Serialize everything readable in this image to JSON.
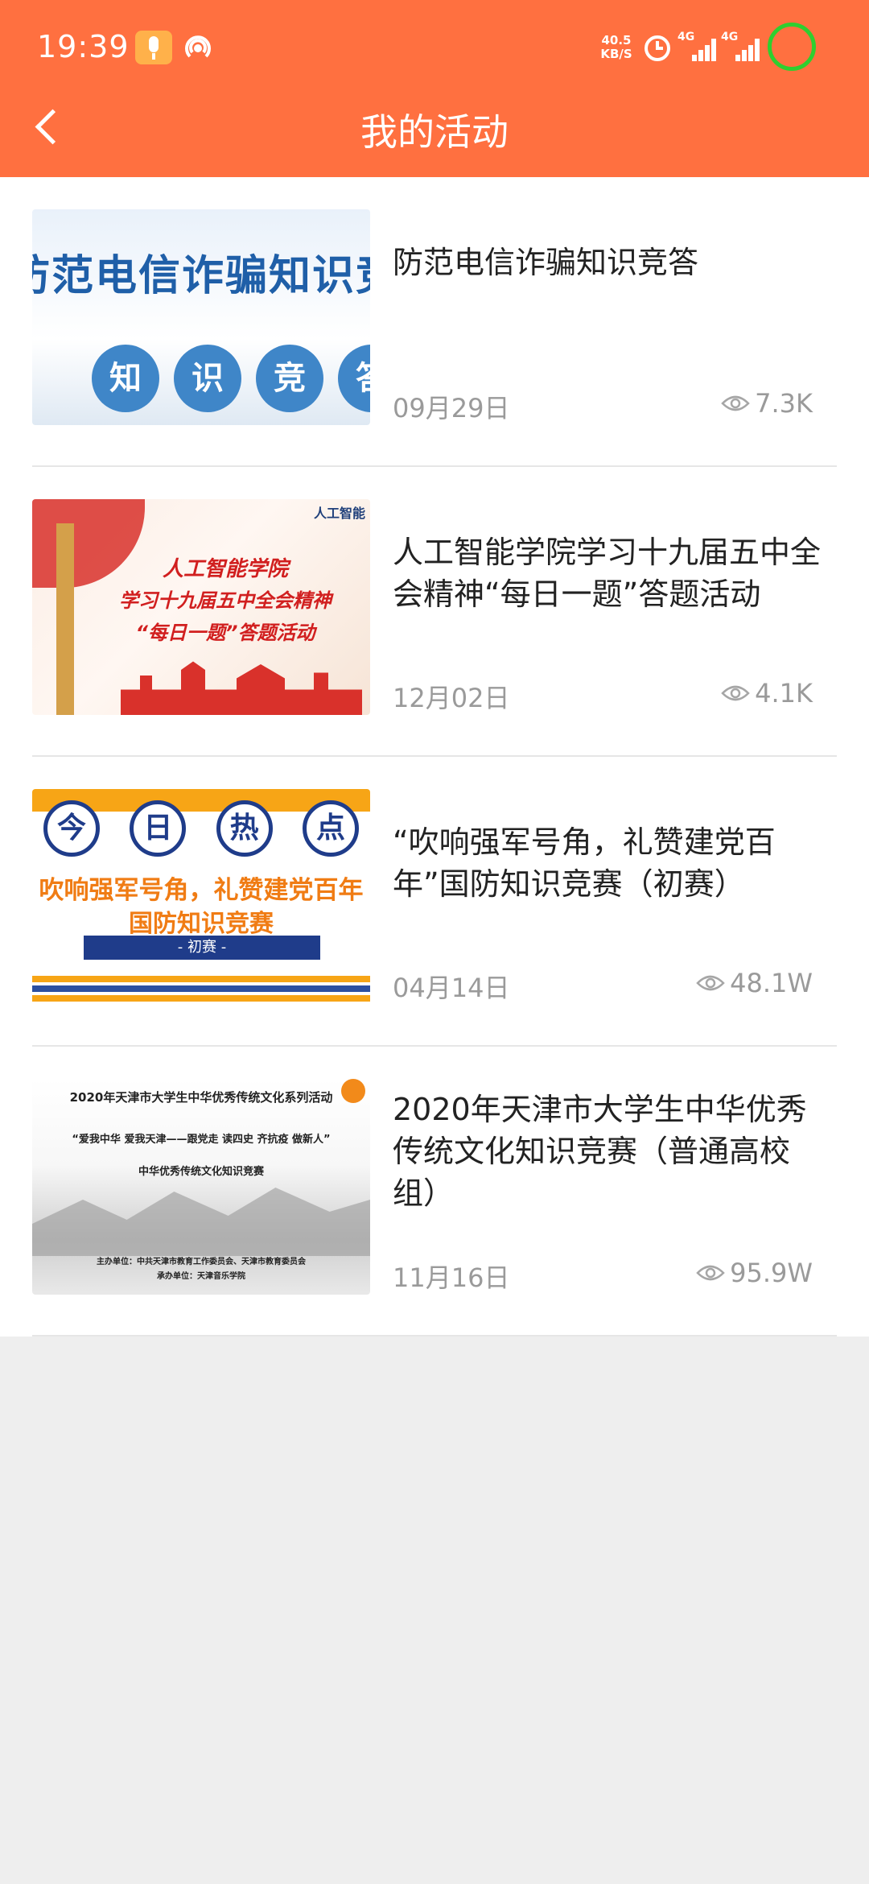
{
  "status_bar": {
    "time": "19:39",
    "net_speed_value": "40.5",
    "net_speed_unit": "KB/S",
    "signal_1_label": "4G",
    "signal_2_label": "4G"
  },
  "header": {
    "title": "我的活动",
    "background_color": "#ff7040"
  },
  "activities": [
    {
      "title": "防范电信诈骗知识竞答",
      "date": "09月29日",
      "views": "7.3K",
      "thumbnail": {
        "banner": "防范电信诈骗知识竞",
        "chars": [
          "知",
          "识",
          "竞",
          "答"
        ]
      }
    },
    {
      "title": "人工智能学院学习十九届五中全会精神“每日一题”答题活动",
      "date": "12月02日",
      "views": "4.1K",
      "thumbnail": {
        "logo": "人工智能",
        "line1": "人工智能学院",
        "line2": "学习十九届五中全会精神",
        "line3": "“每日一题”答题活动"
      }
    },
    {
      "title": "“吹响强军号角，礼赞建党百年”国防知识竞赛（初赛）",
      "date": "04月14日",
      "views": "48.1W",
      "thumbnail": {
        "chars": [
          "今",
          "日",
          "热",
          "点"
        ],
        "line1": "吹响强军号角，礼赞建党百年",
        "line2": "国防知识竞赛",
        "tag": "- 初赛 -"
      }
    },
    {
      "title": "2020年天津市大学生中华优秀传统文化知识竞赛（普通高校组）",
      "date": "11月16日",
      "views": "95.9W",
      "thumbnail": {
        "line1": "2020年天津市大学生中华优秀传统文化系列活动",
        "line2": "“爱我中华 爱我天津——跟党走 读四史 齐抗疫 做新人”",
        "line3": "中华优秀传统文化知识竞赛",
        "line4": "主办单位：中共天津市教育工作委员会、天津市教育委员会",
        "line5": "承办单位：天津音乐学院"
      }
    }
  ]
}
